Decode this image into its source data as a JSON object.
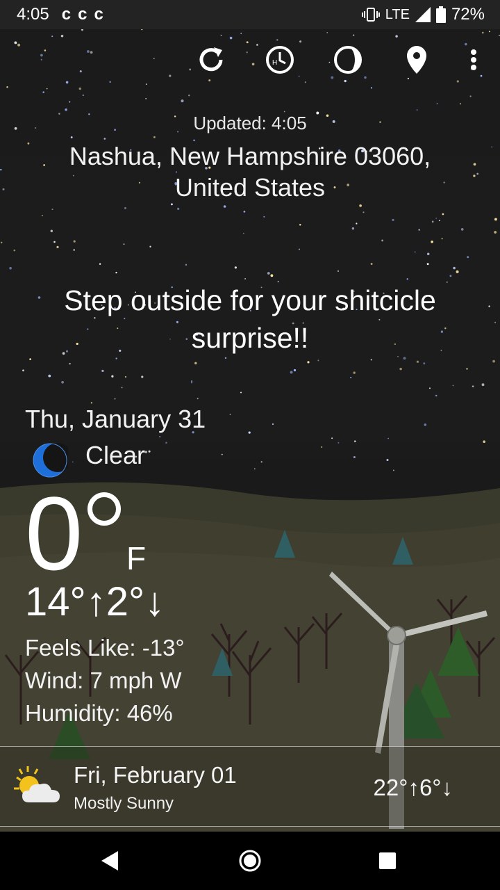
{
  "status_bar": {
    "time": "4:05",
    "notifications": [
      "c-app-icon",
      "c-app-icon",
      "c-app-icon"
    ],
    "network": "LTE",
    "battery": "72%"
  },
  "toolbar": {
    "icons": [
      "refresh-icon",
      "history-clock-icon",
      "moon-phase-icon",
      "location-pin-icon",
      "more-vert-icon"
    ]
  },
  "header": {
    "updated": "Updated: 4:05",
    "location_line1": "Nashua, New Hampshire 03060,",
    "location_line2": "United States"
  },
  "quote": {
    "line1": "Step outside for your shitcicle",
    "line2": "surprise!!"
  },
  "current": {
    "date": "Thu, January 31",
    "condition": "Clear",
    "condition_icon": "crescent-moon-icon",
    "temperature": "0",
    "unit": "F",
    "hi_lo": "14°↑2°↓",
    "feels_like": "Feels Like: -13°",
    "wind": "Wind: 7 mph W",
    "humidity": "Humidity: 46%"
  },
  "forecast": [
    {
      "day": "Fri, February 01",
      "condition": "Mostly Sunny",
      "icon": "partly-sunny-icon",
      "temps": "22°↑6°↓"
    }
  ],
  "nav_bar": {
    "icons": [
      "back-icon",
      "home-icon",
      "recents-icon"
    ]
  },
  "colors": {
    "sky": "#1b1b1b",
    "hills": "#3b3a2b",
    "moon": "#1e6fd9",
    "status_bar": "#232323"
  }
}
